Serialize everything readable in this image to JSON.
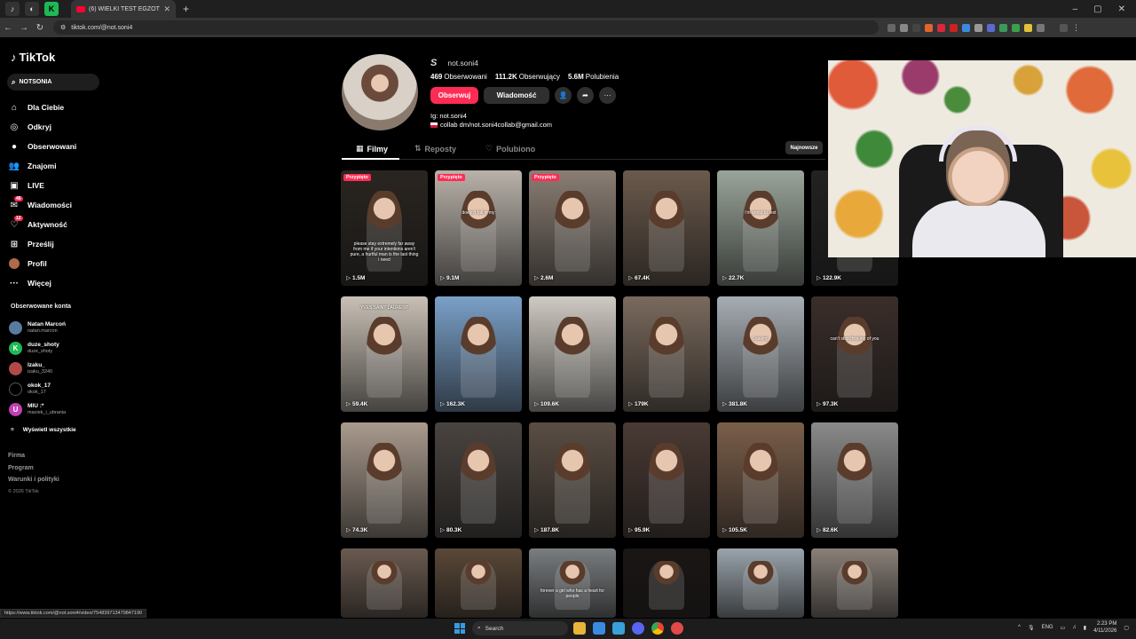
{
  "browser": {
    "active_tab_title": "(6) WIELKI TEST EGZOTYCZNYC",
    "url": "tiktok.com/@not.soni4",
    "status_url": "https://www.tiktok.com/@not.soni4/video/7548397134798471​90"
  },
  "sidebar": {
    "logo": "TikTok",
    "search_value": "NOTSONIA",
    "items": [
      {
        "label": "Dla Ciebie",
        "icon": "home-icon",
        "badge": ""
      },
      {
        "label": "Odkryj",
        "icon": "compass-icon",
        "badge": ""
      },
      {
        "label": "Obserwowani",
        "icon": "following-icon",
        "badge": ""
      },
      {
        "label": "Znajomi",
        "icon": "friends-icon",
        "badge": ""
      },
      {
        "label": "LIVE",
        "icon": "live-icon",
        "badge": ""
      },
      {
        "label": "Wiadomości",
        "icon": "messages-icon",
        "badge": "46"
      },
      {
        "label": "Aktywność",
        "icon": "activity-icon",
        "badge": "12"
      },
      {
        "label": "Prześlij",
        "icon": "upload-icon",
        "badge": ""
      },
      {
        "label": "Profil",
        "icon": "profile-icon",
        "badge": ""
      },
      {
        "label": "Więcej",
        "icon": "more-icon",
        "badge": ""
      }
    ],
    "following_title": "Obserwowane konta",
    "following": [
      {
        "name": "Natan Marcoń",
        "handle": "natan.marcon",
        "color": "#5a7aa0",
        "letter": ""
      },
      {
        "name": "duze_shoty",
        "handle": "duze_shoty",
        "color": "#1db954",
        "letter": "K"
      },
      {
        "name": "Izaku_",
        "handle": "izaku_3240",
        "color": "#b04a4a",
        "letter": ""
      },
      {
        "name": "okok_17",
        "handle": "okok_17",
        "color": "#000000",
        "letter": ""
      },
      {
        "name": "MIU :*",
        "handle": "maciek_i_ubrania",
        "color": "#c13fb5",
        "letter": "U"
      }
    ],
    "show_all": "Wyświetl wszystkie",
    "footer": [
      "Firma",
      "Program",
      "Warunki i polityki"
    ],
    "copyright": "© 2026 TikTok"
  },
  "profile": {
    "username": "not.soni4",
    "stats": [
      {
        "value": "469",
        "label": "Obserwowani"
      },
      {
        "value": "111.2K",
        "label": "Obserwujący"
      },
      {
        "value": "5.6M",
        "label": "Polubienia"
      }
    ],
    "follow_label": "Obserwuj",
    "message_label": "Wiadomość",
    "bio_line1": "Ig: not.soni4",
    "bio_line2": "collab dm/not.soni4collab@gmail.com"
  },
  "tabs": [
    {
      "label": "Filmy",
      "icon": "grid-icon",
      "active": true
    },
    {
      "label": "Reposty",
      "icon": "repost-icon",
      "active": false
    },
    {
      "label": "Polubiono",
      "icon": "liked-icon",
      "active": false
    }
  ],
  "sort_label": "Najnowsze",
  "pinned_label": "Przypięto",
  "videos": [
    {
      "views": "1.5M",
      "pinned": true,
      "color": "#2a2520",
      "text": "please stay extremely far away from me if your intentions aren't pure, a hurtful man is the last thing i need"
    },
    {
      "views": "9.1M",
      "pinned": true,
      "color": "#b9b2aa",
      "text": "doesn't fall in my"
    },
    {
      "views": "2.6M",
      "pinned": true,
      "color": "#8a7e74",
      "text": ""
    },
    {
      "views": "67.4K",
      "pinned": false,
      "color": "#6b5a4c",
      "text": ""
    },
    {
      "views": "22.7K",
      "pinned": false,
      "color": "#9aa59a",
      "text": "i'm about to text"
    },
    {
      "views": "122.9K",
      "pinned": false,
      "color": "#222222",
      "text": ""
    },
    {
      "views": "59.4K",
      "pinned": false,
      "color": "#c9c0b5",
      "text": "YVES SAINT LAURENT"
    },
    {
      "views": "162.3K",
      "pinned": false,
      "color": "#7aa0c8",
      "text": ""
    },
    {
      "views": "109.6K",
      "pinned": false,
      "color": "#cfcac2",
      "text": ""
    },
    {
      "views": "179K",
      "pinned": false,
      "color": "#7a6a5d",
      "text": ""
    },
    {
      "views": "381.8K",
      "pinned": false,
      "color": "#a6adb3",
      "text": "Leaving"
    },
    {
      "views": "97.3K",
      "pinned": false,
      "color": "#3a2e2a",
      "text": "can't stop thinking of you"
    },
    {
      "views": "74.3K",
      "pinned": false,
      "color": "#a99a8d",
      "text": ""
    },
    {
      "views": "80.3K",
      "pinned": false,
      "color": "#4a4440",
      "text": ""
    },
    {
      "views": "187.8K",
      "pinned": false,
      "color": "#5a4e44",
      "text": ""
    },
    {
      "views": "95.9K",
      "pinned": false,
      "color": "#4a3a34",
      "text": ""
    },
    {
      "views": "105.5K",
      "pinned": false,
      "color": "#7a5e4a",
      "text": ""
    },
    {
      "views": "82.6K",
      "pinned": false,
      "color": "#8a8a8a",
      "text": ""
    },
    {
      "views": "",
      "pinned": false,
      "color": "#6a5a50",
      "text": ""
    },
    {
      "views": "",
      "pinned": false,
      "color": "#5a4838",
      "text": ""
    },
    {
      "views": "",
      "pinned": false,
      "color": "#7a7e80",
      "text": "forever a girl who has a heart for people"
    },
    {
      "views": "",
      "pinned": false,
      "color": "#1a1614",
      "text": ""
    },
    {
      "views": "",
      "pinned": false,
      "color": "#9aa4ac",
      "text": ""
    },
    {
      "views": "",
      "pinned": false,
      "color": "#8a8078",
      "text": ""
    }
  ],
  "taskbar": {
    "search_label": "Search",
    "lang": "ENG",
    "time": "2:23 PM",
    "date": "4/11/2026"
  }
}
